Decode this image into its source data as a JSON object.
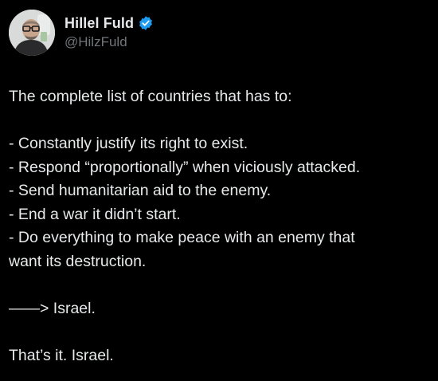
{
  "author": {
    "display_name": "Hillel Fuld",
    "handle": "@HilzFuld",
    "verified_color": "#1d9bf0",
    "avatar_icon": "profile-photo"
  },
  "tweet": {
    "intro": "The complete list of countries that has to:",
    "items": [
      "- Constantly justify its right to exist.",
      "- Respond “proportionally” when viciously attacked.",
      "- Send humanitarian aid to the enemy.",
      "- End a war it didn’t start.",
      "- Do everything to make peace with an enemy that",
      "want its destruction."
    ],
    "arrow_line": "——> Israel.",
    "closing": "That’s it. Israel."
  }
}
